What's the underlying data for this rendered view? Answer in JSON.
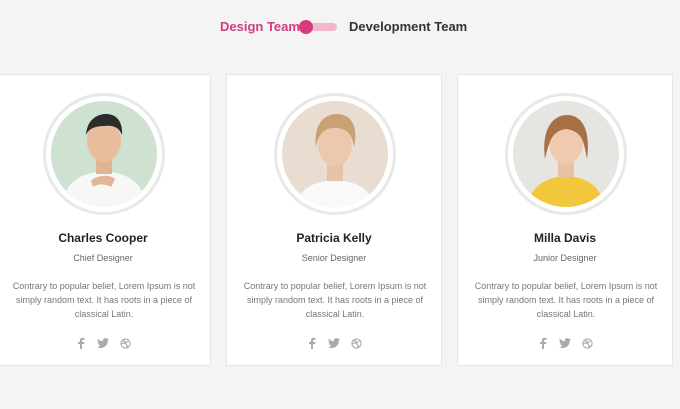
{
  "toggle": {
    "left_label": "Design Team",
    "right_label": "Development Team",
    "active": "Design Team",
    "accent_color": "#d63a7f",
    "track_color": "#f1b7cf"
  },
  "team": [
    {
      "name": "Charles Cooper",
      "role": "Chief Designer",
      "description": "Contrary to popular belief, Lorem Ipsum is not simply random text. It has roots in a piece of classical Latin.",
      "socials": [
        "facebook-icon",
        "twitter-icon",
        "dribbble-icon"
      ]
    },
    {
      "name": "Patricia Kelly",
      "role": "Senior Designer",
      "description": "Contrary to popular belief, Lorem Ipsum is not simply random text. It has roots in a piece of classical Latin.",
      "socials": [
        "facebook-icon",
        "twitter-icon",
        "dribbble-icon"
      ]
    },
    {
      "name": "Milla Davis",
      "role": "Junior Designer",
      "description": "Contrary to popular belief, Lorem Ipsum is not simply random text. It has roots in a piece of classical Latin.",
      "socials": [
        "facebook-icon",
        "twitter-icon",
        "dribbble-icon"
      ]
    }
  ]
}
